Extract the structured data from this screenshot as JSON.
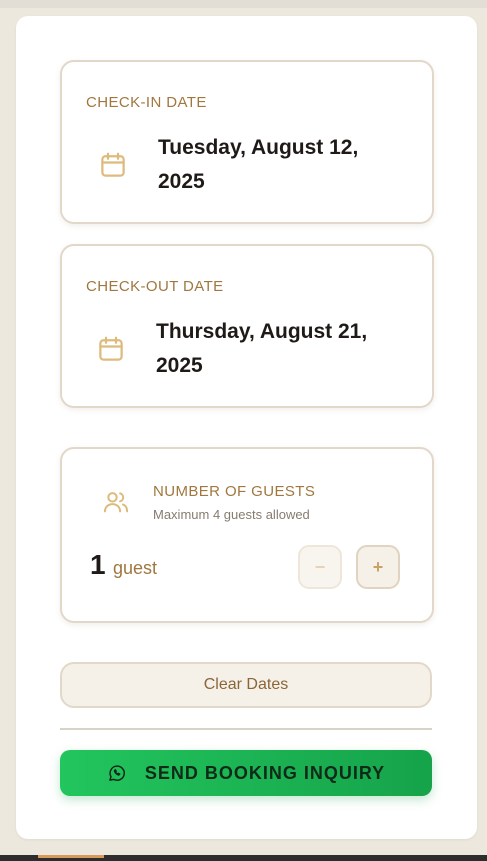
{
  "checkin": {
    "label": "CHECK-IN DATE",
    "date": "Tuesday, August 12, 2025",
    "icon": "calendar-icon"
  },
  "checkout": {
    "label": "CHECK-OUT DATE",
    "date": "Thursday, August 21, 2025",
    "icon": "calendar-icon"
  },
  "guests": {
    "label": "NUMBER OF GUESTS",
    "sublabel": "Maximum 4 guests allowed",
    "count": "1",
    "unit": "guest",
    "minus_label": "−",
    "plus_label": "+",
    "icon": "users-icon"
  },
  "actions": {
    "clear_label": "Clear Dates",
    "send_label": "SEND BOOKING INQUIRY",
    "send_icon": "whatsapp-icon"
  },
  "colors": {
    "accent": "#a0773f",
    "send_button": "#22c55e",
    "card_border": "#e2d8c9"
  }
}
